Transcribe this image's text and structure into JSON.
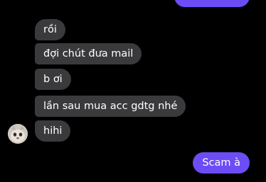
{
  "conversation": {
    "incoming": [
      {
        "text": "rồi"
      },
      {
        "text": "đợi chút đưa mail"
      },
      {
        "text": "b ơi"
      },
      {
        "text": "lần sau mua acc gdtg nhé"
      },
      {
        "text": "hihi"
      }
    ],
    "outgoing_last": {
      "text": "Scam à"
    },
    "colors": {
      "incoming_bubble": "#3a3a3c",
      "outgoing_bubble": "#6c4df5",
      "background": "#000000"
    }
  }
}
